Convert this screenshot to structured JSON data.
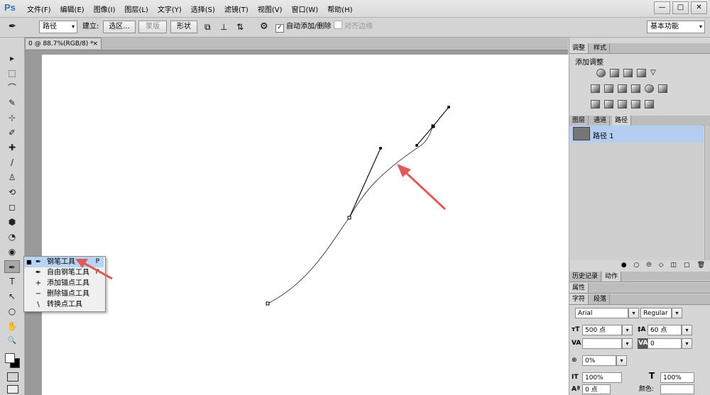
{
  "app": {
    "logo": "Ps"
  },
  "menu": [
    "文件(F)",
    "编辑(E)",
    "图像(I)",
    "图层(L)",
    "文字(Y)",
    "选择(S)",
    "滤镜(T)",
    "视图(V)",
    "窗口(W)",
    "帮助(H)"
  ],
  "window_buttons": [
    "—",
    "□",
    "✕"
  ],
  "options": {
    "mode": "路径",
    "make_label": "建立:",
    "selection_btn": "选区...",
    "mask_btn": "蒙版",
    "shape_btn": "形状",
    "auto_add_delete": "自动添加/删除",
    "align_edges": "对齐边缘",
    "workspace": "基本功能"
  },
  "document": {
    "tab_label": "0 @ 88.7%(RGB/8) *",
    "close": "×"
  },
  "tools": [
    {
      "icon": "▸"
    },
    {
      "icon": "⬚"
    },
    {
      "icon": "⌒"
    },
    {
      "icon": "✎"
    },
    {
      "icon": "⊹"
    },
    {
      "icon": "✐"
    },
    {
      "icon": "✚"
    },
    {
      "icon": "/"
    },
    {
      "icon": "♙"
    },
    {
      "icon": "⟲"
    },
    {
      "icon": "◻"
    },
    {
      "icon": "⬢"
    },
    {
      "icon": "◔"
    },
    {
      "icon": "◉"
    },
    {
      "icon": "✒"
    },
    {
      "icon": "T"
    },
    {
      "icon": "↖"
    },
    {
      "icon": "○"
    },
    {
      "icon": "✋"
    },
    {
      "icon": "🔍"
    }
  ],
  "flyout": {
    "items": [
      {
        "label": "钢笔工具",
        "icon": "✒",
        "key": "P",
        "selected": true
      },
      {
        "label": "自由钢笔工具",
        "icon": "✒",
        "key": "P",
        "selected": false
      },
      {
        "label": "添加锚点工具",
        "icon": "+",
        "key": "",
        "selected": false
      },
      {
        "label": "删除锚点工具",
        "icon": "−",
        "key": "",
        "selected": false
      },
      {
        "label": "转换点工具",
        "icon": "\\",
        "key": "",
        "selected": false
      }
    ]
  },
  "panels": {
    "adjust_tabs": [
      "调整",
      "样式"
    ],
    "adjust_title": "添加调整",
    "layer_tabs": [
      "图层",
      "通道",
      "路径"
    ],
    "path_item": "路径 1",
    "history_tabs": [
      "历史记录",
      "动作"
    ],
    "properties_tab": "属性",
    "char_tabs": [
      "字符",
      "段落"
    ]
  },
  "character": {
    "font": "Arial",
    "style": "Regular",
    "size": "500 点",
    "leading": "60 点",
    "tracking": "0",
    "kerning_value": "0%",
    "vscale": "100%",
    "hscale": "100%",
    "baseline": "0 点",
    "color_label": "颜色:"
  },
  "colors": {
    "arrow": "#e05a5a",
    "accent": "#b4cdf0"
  }
}
